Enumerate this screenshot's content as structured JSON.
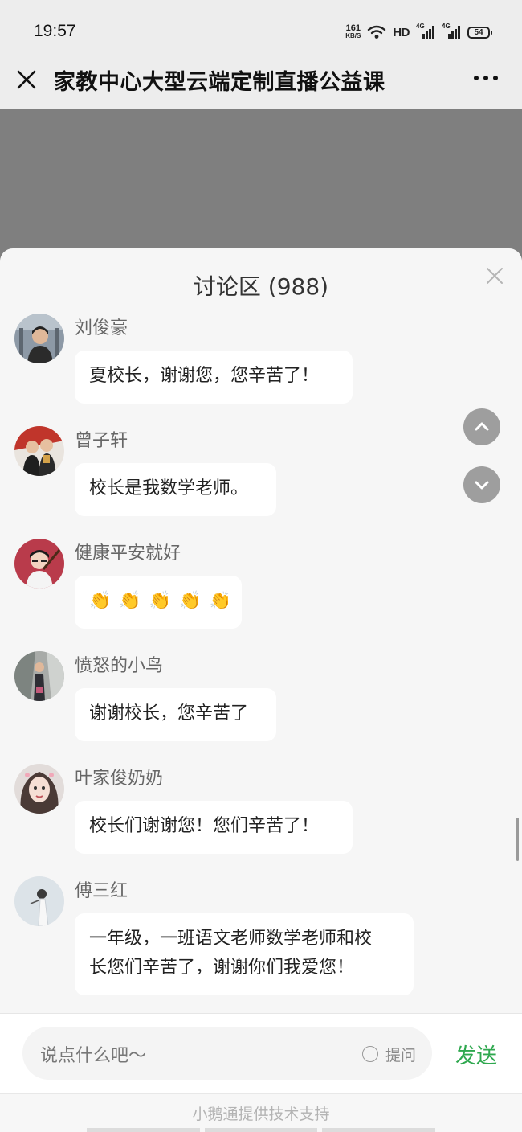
{
  "status_bar": {
    "time": "19:57",
    "net_speed_value": "161",
    "net_speed_unit": "KB/S",
    "hd_label": "HD",
    "signal_1_label": "4G",
    "signal_2_label": "4G",
    "battery": "54"
  },
  "header": {
    "title": "家教中心大型云端定制直播公益课",
    "close_icon": "close-icon",
    "more_icon": "more-icon"
  },
  "discussion": {
    "title": "讨论区 (988)",
    "messages": [
      {
        "name": "刘俊豪",
        "text": "夏校长，谢谢您，您辛苦了！"
      },
      {
        "name": "曾子轩",
        "text": "校长是我数学老师。"
      },
      {
        "name": "健康平安就好",
        "text": "👏👏👏👏👏",
        "claps": [
          "👏",
          "👏",
          "👏",
          "👏",
          "👏"
        ]
      },
      {
        "name": "愤怒的小鸟",
        "text": "谢谢校长，您辛苦了"
      },
      {
        "name": "叶家俊奶奶",
        "text": "校长们谢谢您！您们辛苦了！"
      },
      {
        "name": "傅三红",
        "text_line1": "一年级，一班语文老师数学老师和校",
        "text_line2": "长您们辛苦了，谢谢你们我爱您！"
      }
    ]
  },
  "input": {
    "placeholder": "说点什么吧～",
    "ask_label": "提问",
    "send_label": "发送"
  },
  "footer": {
    "text": "小鹅通提供技术支持"
  },
  "colors": {
    "accent_green": "#2fa84f",
    "backdrop": "#7f7f7f",
    "panel_bg": "#f6f6f6",
    "bubble_bg": "#ffffff"
  }
}
